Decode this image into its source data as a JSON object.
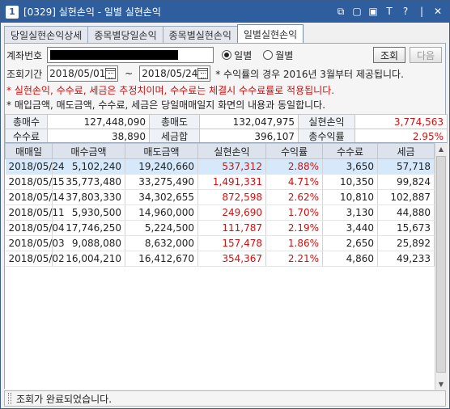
{
  "window": {
    "number": "1",
    "title": "[0329] 실현손익 - 일별 실현손익"
  },
  "title_icons": [
    "⧉",
    "▢",
    "▣",
    "T",
    "?",
    "|",
    "✕"
  ],
  "tabs": [
    {
      "label": "당일실현손익상세"
    },
    {
      "label": "종목별당일손익"
    },
    {
      "label": "종목별실현손익"
    },
    {
      "label": "일별실현손익"
    }
  ],
  "form": {
    "account_label": "계좌번호",
    "period_label": "조회기간",
    "date_from": "2018/05/01",
    "date_sep": "~",
    "date_to": "2018/05/24",
    "radio_daily": "일별",
    "radio_monthly": "월별",
    "query_button": "조회",
    "next_button": "다음",
    "period_note": "* 수익률의 경우 2016년 3월부터 제공됩니다."
  },
  "notes": {
    "red": "* 실현손익, 수수료, 세금은 추정치이며, 수수료는 체결시 수수료률로 적용됩니다.",
    "black": "* 매입금액, 매도금액, 수수료, 세금은 당일매매일지 화면의 내용과 동일합니다."
  },
  "summary": {
    "total_buy_label": "총매수",
    "total_buy": "127,448,090",
    "total_sell_label": "총매도",
    "total_sell": "132,047,975",
    "realized_label": "실현손익",
    "realized": "3,774,563",
    "fee_label": "수수료",
    "fee": "38,890",
    "tax_label": "세금합",
    "tax": "396,107",
    "return_label": "총수익률",
    "return": "2.95%"
  },
  "columns": [
    "매매일",
    "매수금액",
    "매도금액",
    "실현손익",
    "수익률",
    "수수료",
    "세금"
  ],
  "rows": [
    {
      "date": "2018/05/24",
      "buy": "5,102,240",
      "sell": "19,240,660",
      "pnl": "537,312",
      "rate": "2.88%",
      "fee": "3,650",
      "tax": "57,718"
    },
    {
      "date": "2018/05/15",
      "buy": "35,773,480",
      "sell": "33,275,490",
      "pnl": "1,491,331",
      "rate": "4.71%",
      "fee": "10,350",
      "tax": "99,824"
    },
    {
      "date": "2018/05/14",
      "buy": "37,803,330",
      "sell": "34,302,655",
      "pnl": "872,598",
      "rate": "2.62%",
      "fee": "10,810",
      "tax": "102,887"
    },
    {
      "date": "2018/05/11",
      "buy": "5,930,500",
      "sell": "14,960,000",
      "pnl": "249,690",
      "rate": "1.70%",
      "fee": "3,130",
      "tax": "44,880"
    },
    {
      "date": "2018/05/04",
      "buy": "17,746,250",
      "sell": "5,224,500",
      "pnl": "111,787",
      "rate": "2.19%",
      "fee": "3,440",
      "tax": "15,673"
    },
    {
      "date": "2018/05/03",
      "buy": "9,088,080",
      "sell": "8,632,000",
      "pnl": "157,478",
      "rate": "1.86%",
      "fee": "2,650",
      "tax": "25,892"
    },
    {
      "date": "2018/05/02",
      "buy": "16,004,210",
      "sell": "16,412,670",
      "pnl": "354,367",
      "rate": "2.21%",
      "fee": "4,860",
      "tax": "49,233"
    }
  ],
  "status": "조회가 완료되었습니다.",
  "colors": {
    "titlebar": "#2f5e9e",
    "profit": "#d01010",
    "selected_row": "#d5e9fb"
  }
}
